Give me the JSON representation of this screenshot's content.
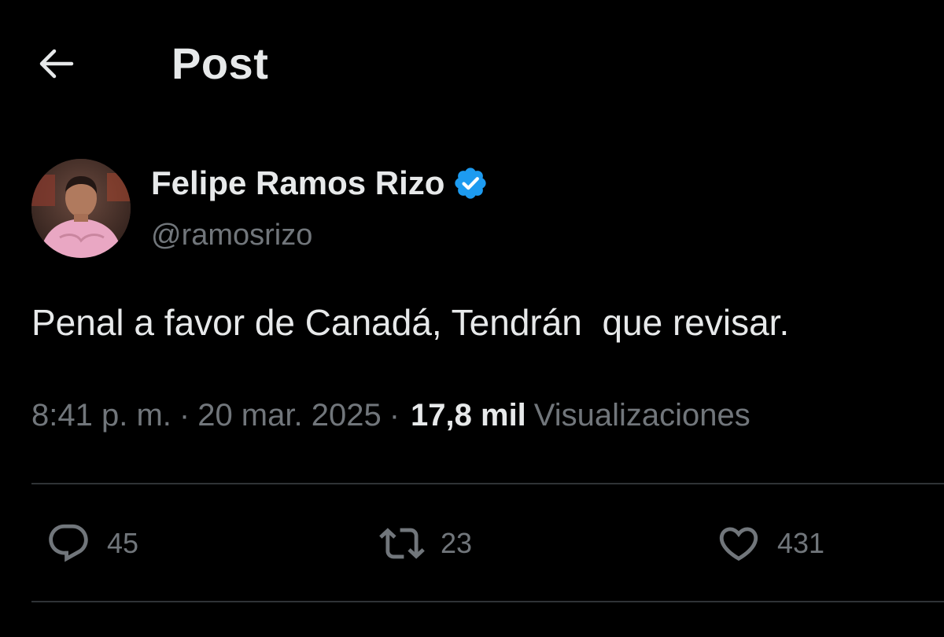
{
  "header": {
    "title": "Post"
  },
  "author": {
    "name": "Felipe Ramos Rizo",
    "handle": "@ramosrizo",
    "verified": true
  },
  "post": {
    "text": "Penal a favor de Canadá, Tendrán  que revisar.",
    "time": "8:41 p. m.",
    "date": "20 mar. 2025",
    "views_count": "17,8 mil",
    "views_label": "Visualizaciones"
  },
  "actions": {
    "replies": "45",
    "reposts": "23",
    "likes": "431"
  },
  "colors": {
    "background": "#000000",
    "text": "#e7e9ea",
    "muted": "#71767b",
    "verified": "#1d9bf0",
    "divider": "#2f3336"
  },
  "icons": {
    "back": "arrow-left-icon",
    "verified": "verified-badge-icon",
    "reply": "reply-icon",
    "repost": "repost-icon",
    "like": "heart-icon"
  }
}
